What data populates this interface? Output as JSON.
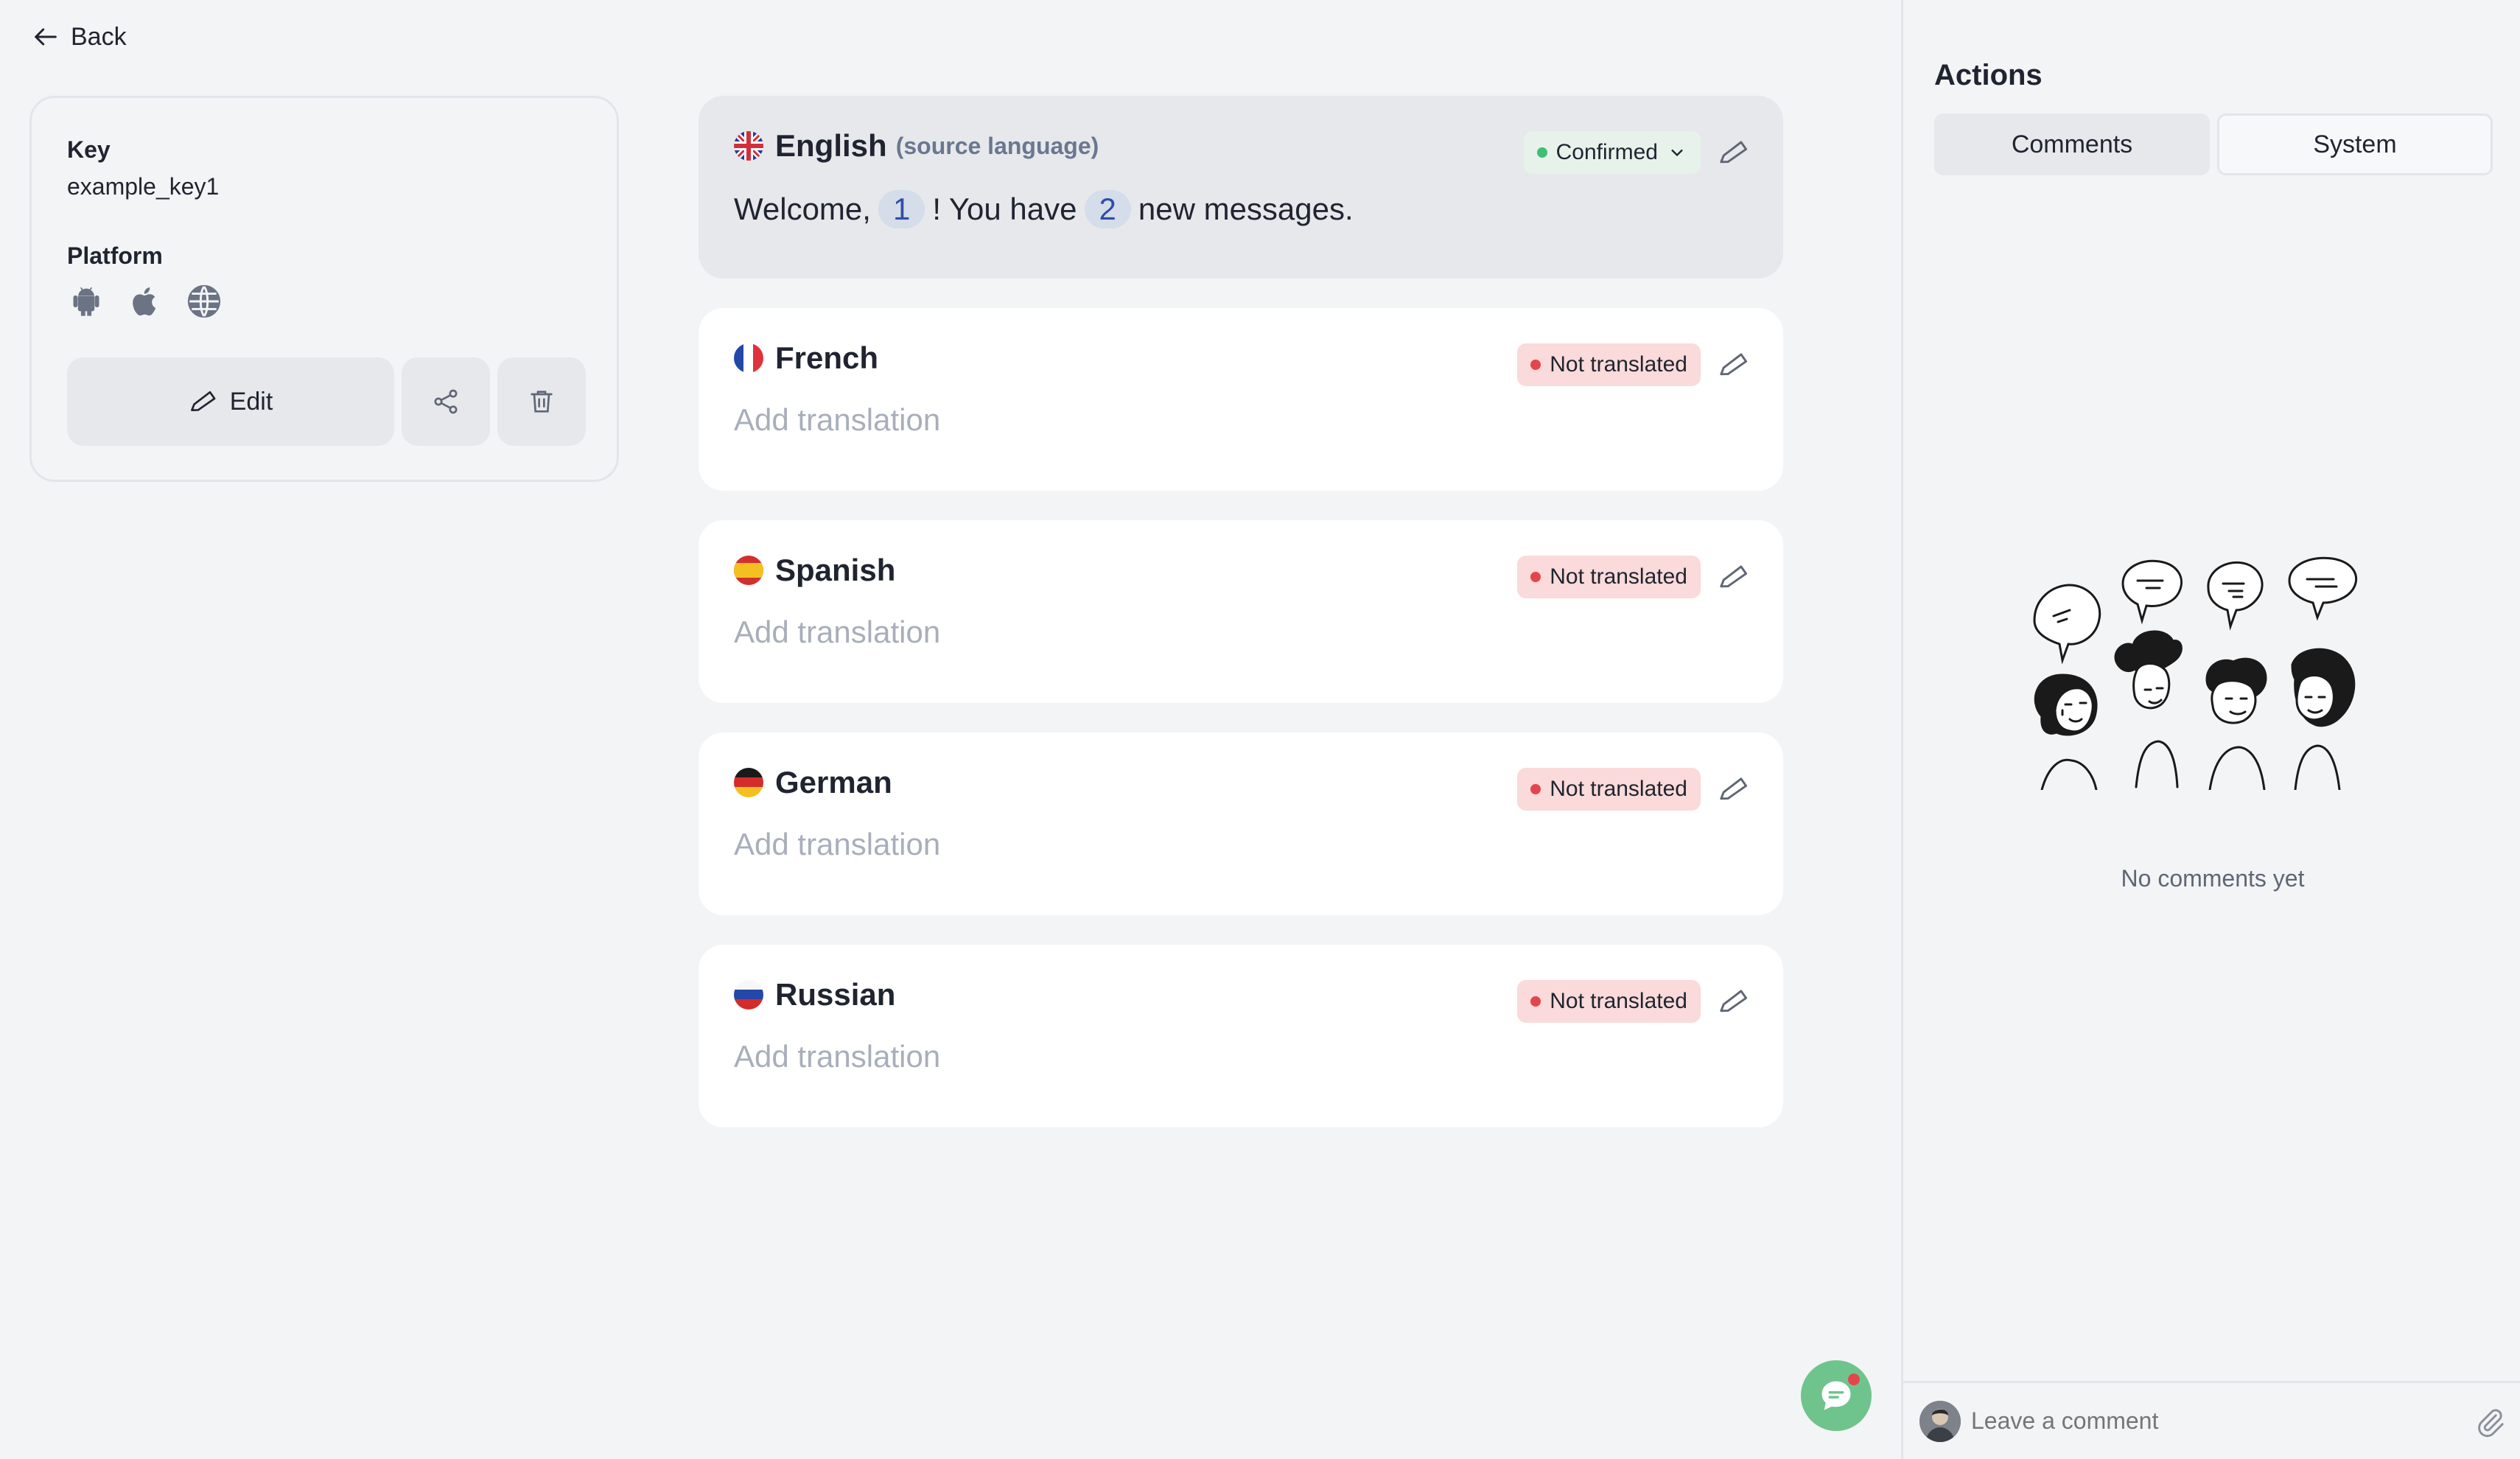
{
  "nav": {
    "back_label": "Back"
  },
  "key_card": {
    "key_label": "Key",
    "key_value": "example_key1",
    "platform_label": "Platform",
    "platform_icons": [
      "android-icon",
      "apple-icon",
      "globe-icon"
    ],
    "edit_label": "Edit"
  },
  "translations": [
    {
      "language": "English",
      "note": "(source language)",
      "status": "Confirmed",
      "flag": "uk",
      "text_parts": [
        "Welcome,",
        "1",
        "! You have",
        "2",
        "new messages."
      ]
    },
    {
      "language": "French",
      "status": "Not translated",
      "flag": "fr",
      "placeholder": "Add translation"
    },
    {
      "language": "Spanish",
      "status": "Not translated",
      "flag": "es",
      "placeholder": "Add translation"
    },
    {
      "language": "German",
      "status": "Not translated",
      "flag": "de",
      "placeholder": "Add translation"
    },
    {
      "language": "Russian",
      "status": "Not translated",
      "flag": "ru",
      "placeholder": "Add translation"
    }
  ],
  "panel": {
    "title": "Actions",
    "tabs": [
      "Comments",
      "System"
    ],
    "active_tab": "Comments",
    "empty_text": "No comments yet",
    "comment_placeholder": "Leave a comment"
  },
  "colors": {
    "confirmed_dot": "#3fbf73",
    "not_translated_dot": "#e4454b",
    "chip_text": "#2d4fa8",
    "chat_button": "#6fc48d"
  }
}
